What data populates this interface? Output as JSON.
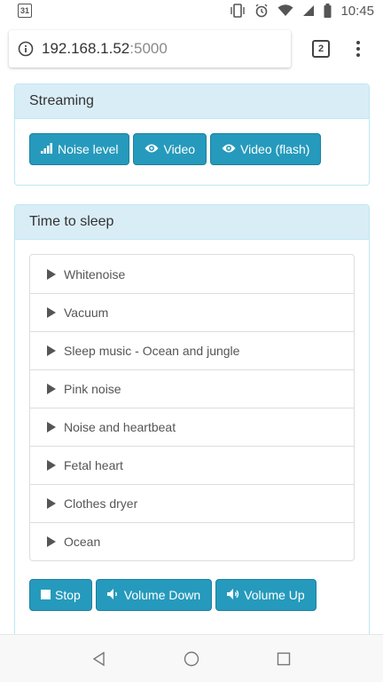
{
  "status_bar": {
    "calendar_day": "31",
    "time": "10:45"
  },
  "browser": {
    "url_host": "192.168.1.52",
    "url_port": ":5000",
    "tab_count": "2"
  },
  "streaming": {
    "title": "Streaming",
    "buttons": [
      {
        "label": "Noise level",
        "icon": "signal-bars-icon"
      },
      {
        "label": "Video",
        "icon": "eye-icon"
      },
      {
        "label": "Video (flash)",
        "icon": "eye-icon"
      }
    ]
  },
  "sleep": {
    "title": "Time to sleep",
    "tracks": [
      "Whitenoise",
      "Vacuum",
      "Sleep music - Ocean and jungle",
      "Pink noise",
      "Noise and heartbeat",
      "Fetal heart",
      "Clothes dryer",
      "Ocean"
    ],
    "controls": [
      {
        "label": "Stop",
        "icon": "stop-icon"
      },
      {
        "label": "Volume Down",
        "icon": "volume-down-icon"
      },
      {
        "label": "Volume Up",
        "icon": "volume-up-icon"
      }
    ]
  },
  "colors": {
    "button": "#269abc",
    "panel_heading": "#d9edf7",
    "panel_border": "#bce8f1"
  }
}
